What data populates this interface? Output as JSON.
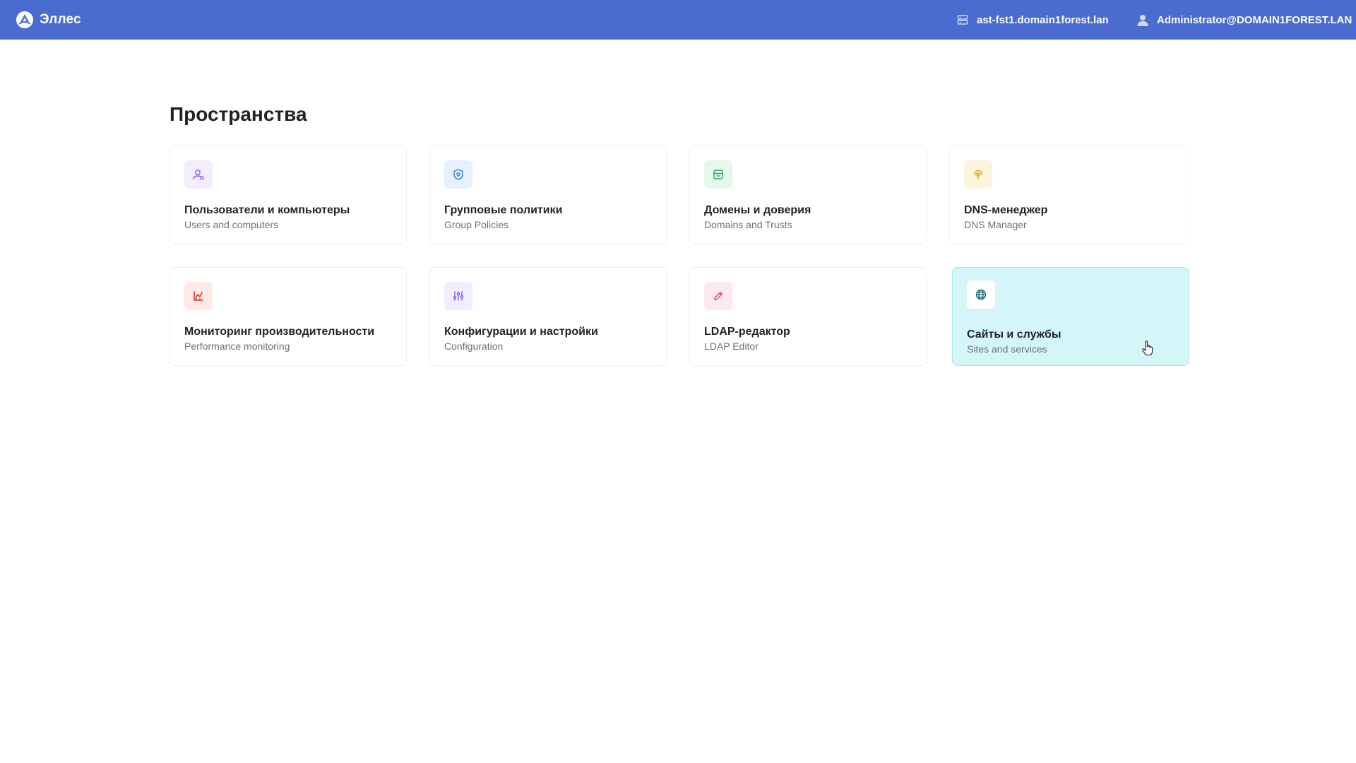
{
  "header": {
    "brand": "Эллес",
    "host": "ast-fst1.domain1forest.lan",
    "user": "Administrator@DOMAIN1FOREST.LAN",
    "bg_color": "#4a6bd0",
    "icons": {
      "brand": "elles-logo-icon",
      "host": "server-icon",
      "user": "user-icon"
    }
  },
  "main": {
    "title": "Пространства",
    "cards": [
      {
        "title": "Пользователи и компьютеры",
        "subtitle": "Users and computers",
        "icon": "users-icon",
        "icon_color": "#8a5cf5",
        "icon_bg": "#f3eefe"
      },
      {
        "title": "Групповые политики",
        "subtitle": "Group Policies",
        "icon": "shield-icon",
        "icon_color": "#2f7bd8",
        "icon_bg": "#e5f1fd"
      },
      {
        "title": "Домены и доверия",
        "subtitle": "Domains and Trusts",
        "icon": "domain-icon",
        "icon_color": "#2e9e5b",
        "icon_bg": "#e6f7ec"
      },
      {
        "title": "DNS-менеджер",
        "subtitle": "DNS Manager",
        "icon": "dns-signal-icon",
        "icon_color": "#e0a21a",
        "icon_bg": "#fdf4dc"
      },
      {
        "title": "Мониторинг производительности",
        "subtitle": "Performance monitoring",
        "icon": "chart-icon",
        "icon_color": "#e0342c",
        "icon_bg": "#fde9e8"
      },
      {
        "title": "Конфигурации и настройки",
        "subtitle": "Configuration",
        "icon": "sliders-icon",
        "icon_color": "#8a5cf5",
        "icon_bg": "#f3eefe"
      },
      {
        "title": "LDAP-редактор",
        "subtitle": "LDAP Editor",
        "icon": "pencil-icon",
        "icon_color": "#e04777",
        "icon_bg": "#fde9ef"
      },
      {
        "title": "Сайты и службы",
        "subtitle": "Sites and services",
        "icon": "globe-icon",
        "icon_color": "#1a6b77",
        "icon_bg": "#ffffff",
        "active": true
      }
    ]
  }
}
